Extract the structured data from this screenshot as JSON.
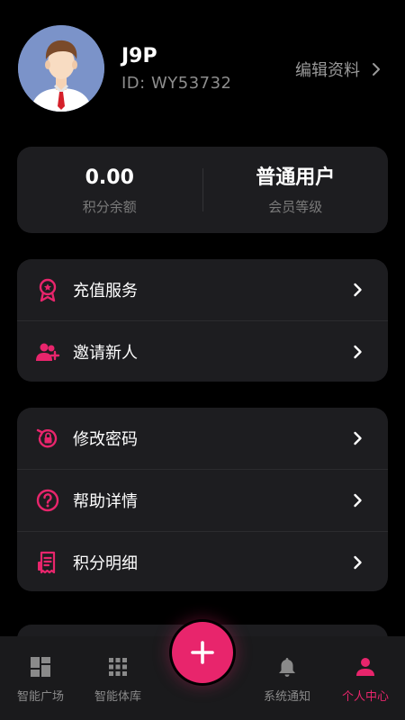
{
  "profile": {
    "username": "J9P",
    "user_id": "ID: WY53732",
    "edit_label": "编辑资料"
  },
  "stats": [
    {
      "value": "0.00",
      "label": "积分余额"
    },
    {
      "value": "普通用户",
      "label": "会员等级"
    }
  ],
  "menu_group_1": [
    {
      "label": "充值服务",
      "icon": "award-ribbon-icon"
    },
    {
      "label": "邀请新人",
      "icon": "add-user-icon"
    }
  ],
  "menu_group_2": [
    {
      "label": "修改密码",
      "icon": "lock-reset-icon"
    },
    {
      "label": "帮助详情",
      "icon": "question-circle-icon"
    },
    {
      "label": "积分明细",
      "icon": "receipt-icon"
    }
  ],
  "tabs": [
    {
      "label": "智能广场",
      "icon": "dashboard-grid-icon",
      "active": false
    },
    {
      "label": "智能体库",
      "icon": "app-grid-icon",
      "active": false
    },
    {
      "label": "系统通知",
      "icon": "bell-icon",
      "active": false
    },
    {
      "label": "个人中心",
      "icon": "person-icon",
      "active": true
    }
  ],
  "colors": {
    "accent": "#e8256c",
    "background": "#000000",
    "card": "#1d1d20",
    "tabbar": "#1a1a1c",
    "muted_text": "#8a8a8a"
  }
}
